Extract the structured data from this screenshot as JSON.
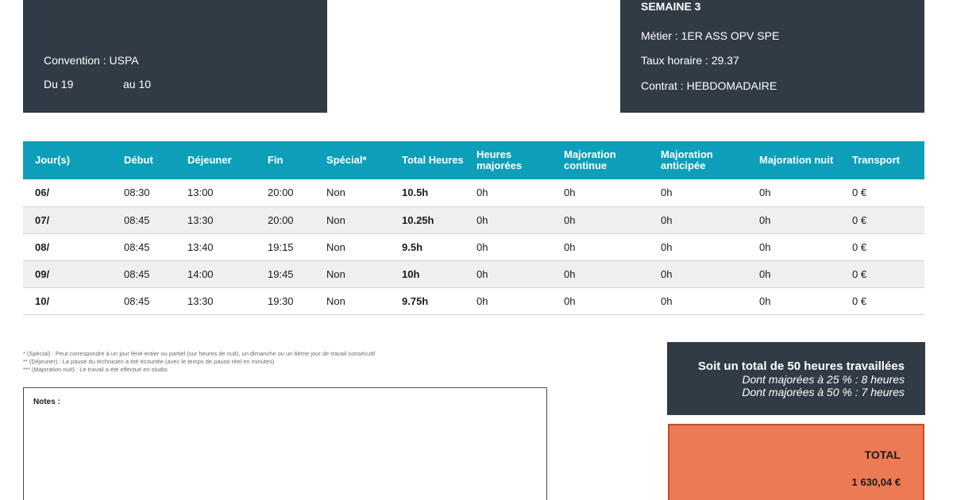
{
  "header_left": {
    "convention": "Convention : USPA",
    "from": "Du 19",
    "to": "au 10"
  },
  "header_right": {
    "week": "SEMAINE 3",
    "job": "Métier : 1ER ASS OPV SPE",
    "rate": "Taux horaire : 29.37",
    "contract": "Contrat : HEBDOMADAIRE"
  },
  "table": {
    "headers": [
      "Jour(s)",
      "Début",
      "Déjeuner",
      "Fin",
      "Spécial*",
      "Total Heures",
      "Heures majorées",
      "Majoration continue",
      "Majoration anticipée",
      "Majoration nuit",
      "Transport"
    ],
    "rows": [
      [
        "06/",
        "08:30",
        "13:00",
        "20:00",
        "Non",
        "10.5h",
        "0h",
        "0h",
        "0h",
        "0h",
        "0 €"
      ],
      [
        "07/",
        "08:45",
        "13:30",
        "20:00",
        "Non",
        "10.25h",
        "0h",
        "0h",
        "0h",
        "0h",
        "0 €"
      ],
      [
        "08/",
        "08:45",
        "13:40",
        "19:15",
        "Non",
        "9.5h",
        "0h",
        "0h",
        "0h",
        "0h",
        "0 €"
      ],
      [
        "09/",
        "08:45",
        "14:00",
        "19:45",
        "Non",
        "10h",
        "0h",
        "0h",
        "0h",
        "0h",
        "0 €"
      ],
      [
        "10/",
        "08:45",
        "13:30",
        "19:30",
        "Non",
        "9.75h",
        "0h",
        "0h",
        "0h",
        "0h",
        "0 €"
      ]
    ]
  },
  "footnotes": [
    "* (Spécial) : Peut correspondre à un jour férié entier ou partiel (sur heures de nuit), un dimanche ou un 6ème jour de travail consécutif",
    "** (Déjeuner) : La pause du technicien a été écourtée (avec le temps de pause réel en minutes)",
    "*** (Majoration nuit) : Le travail a été effectué en studio"
  ],
  "notes": {
    "label": "Notes :"
  },
  "summary": {
    "total_hours": "Soit un total de 50 heures travaillées",
    "majored_25": "Dont majorées à 25 % : 8 heures",
    "majored_50": "Dont majorées à 50 % : 7 heures"
  },
  "total": {
    "label": "TOTAL",
    "amount": "1 630,04 €"
  },
  "colors": {
    "dark_panel": "#313b46",
    "table_header": "#0d9fba",
    "total_box": "#ec7a55"
  }
}
